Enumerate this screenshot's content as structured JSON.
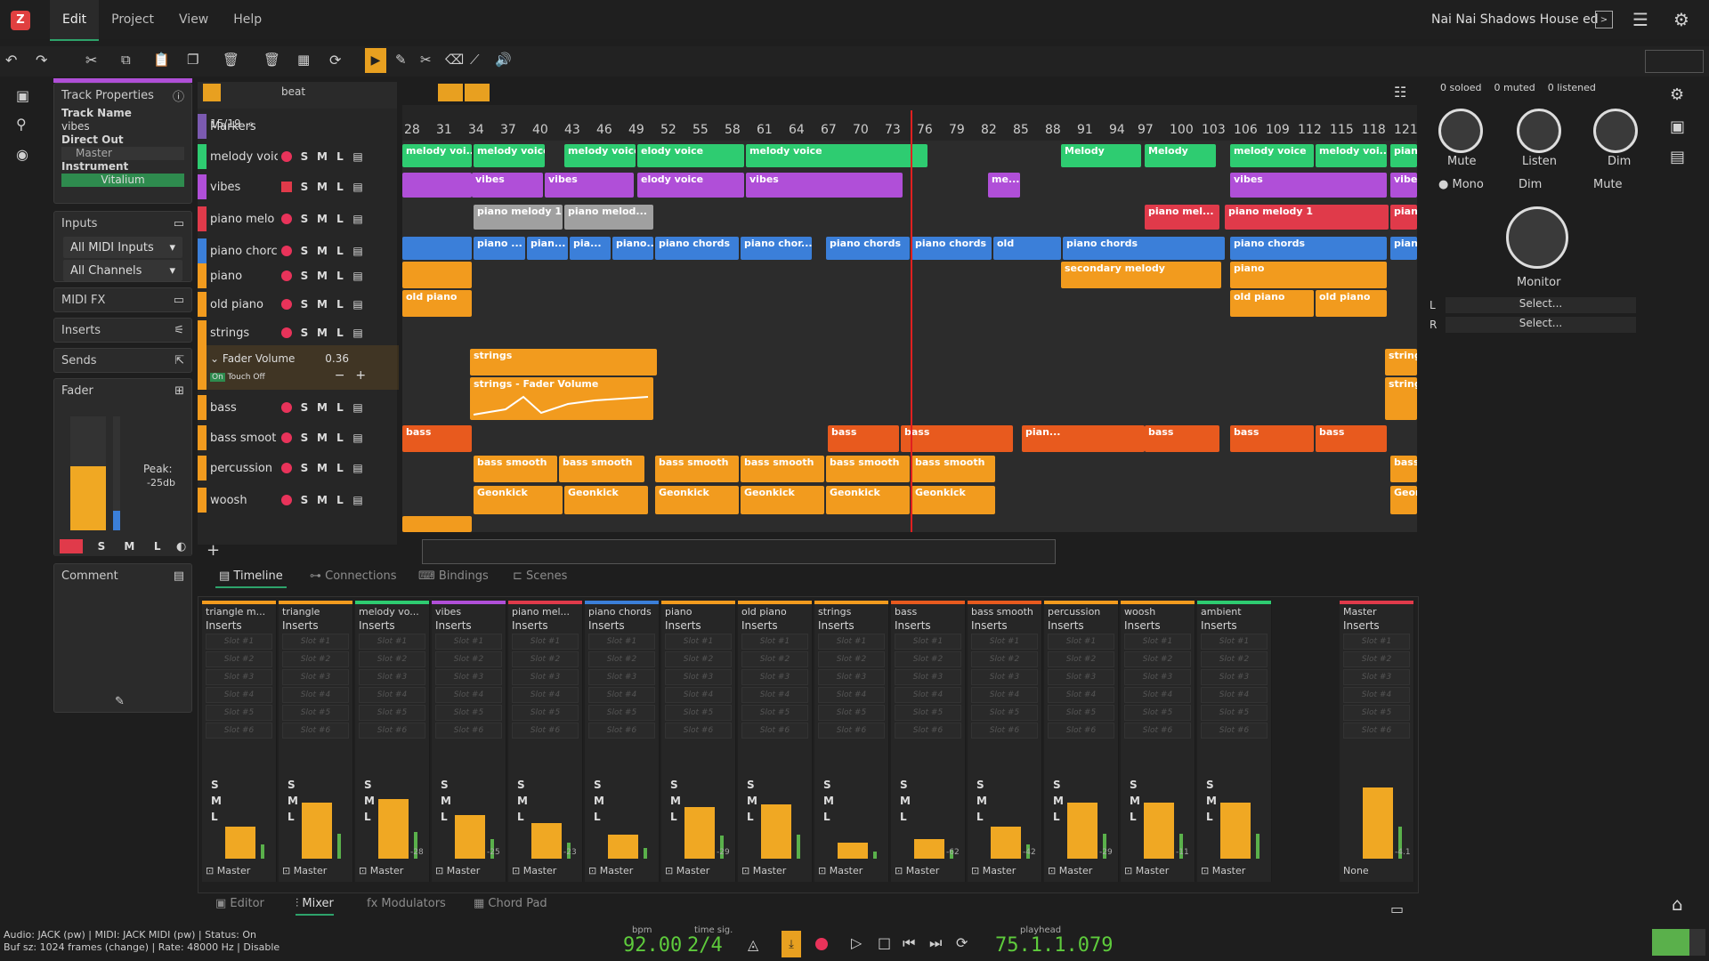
{
  "app": {
    "menu": [
      "Edit",
      "Project",
      "View",
      "Help"
    ],
    "project_name": "Nai Nai Shadows House ed"
  },
  "left": {
    "track_properties": "Track Properties",
    "track_name_lbl": "Track Name",
    "track_name": "vibes",
    "direct_out_lbl": "Direct Out",
    "direct_out": "Master",
    "instrument_lbl": "Instrument",
    "instrument": "Vitalium",
    "inputs": "Inputs",
    "midi_inputs": "All MIDI Inputs",
    "channels": "All Channels",
    "midi_fx": "MIDI FX",
    "inserts": "Inserts",
    "sends": "Sends",
    "fader": "Fader",
    "peak": "Peak:",
    "peak_val": "-25db",
    "comment": "Comment"
  },
  "tracklist": {
    "counter": "15/19",
    "markers": "Markers",
    "snap": "beat",
    "fader_volume": "Fader Volume",
    "fader_value": "0.36",
    "on": "On",
    "touch": "Touch",
    "off": "Off"
  },
  "tracks": [
    {
      "name": "melody voic",
      "color": "#2ecc71"
    },
    {
      "name": "vibes",
      "color": "#b04fd8"
    },
    {
      "name": "piano melo",
      "color": "#e03a4a"
    },
    {
      "name": "piano chorc",
      "color": "#3b7fd9"
    },
    {
      "name": "piano",
      "color": "#f29b1e"
    },
    {
      "name": "old piano",
      "color": "#f29b1e"
    },
    {
      "name": "strings",
      "color": "#f29b1e"
    },
    {
      "name": "bass",
      "color": "#f29b1e"
    },
    {
      "name": "bass smoot",
      "color": "#f29b1e"
    },
    {
      "name": "percussion",
      "color": "#f29b1e"
    },
    {
      "name": "woosh",
      "color": "#f29b1e"
    }
  ],
  "ruler": [
    "28",
    "31",
    "34",
    "37",
    "40",
    "43",
    "46",
    "49",
    "52",
    "55",
    "58",
    "61",
    "64",
    "67",
    "70",
    "73",
    "76",
    "79",
    "82",
    "85",
    "88",
    "91",
    "94",
    "97",
    "100",
    "103",
    "106",
    "109",
    "112",
    "115",
    "118",
    "121"
  ],
  "clips": {
    "melody": [
      "melody voi...",
      "melody voice",
      "melody voice",
      "elody voice",
      "melody voice",
      "Melody",
      "Melody",
      "melody voice",
      "melody voi...",
      "pian"
    ],
    "vibes": [
      "vibes",
      "vibes",
      "vibes",
      "elody voice",
      "vibes",
      "me...",
      "vibes",
      "vibes"
    ],
    "pmel": [
      "piano melody 1",
      "piano melod...",
      "piano mel...",
      "piano melody 1",
      "pian"
    ],
    "pch": [
      "piano ...",
      "pian...",
      "pia...",
      "piano...",
      "piano chords",
      "piano chor...",
      "piano chords",
      "piano chords",
      "old",
      "piano chords",
      "piano chords",
      "pian"
    ],
    "piano": [
      "secondary melody",
      "piano"
    ],
    "old": [
      "old piano",
      "old piano",
      "old piano"
    ],
    "strings": [
      "strings",
      "string",
      "strings - Fader Volume",
      "string"
    ],
    "bass": [
      "bass",
      "bass",
      "bass",
      "pian...",
      "bass",
      "bass",
      "bass",
      "bass"
    ],
    "bsm": [
      "bass smooth",
      "bass smooth",
      "bass smooth",
      "bass smooth",
      "bass smooth",
      "bass smooth",
      "bass"
    ],
    "perc": [
      "Geonkick",
      "Geonkick",
      "Geonkick",
      "Geonkick",
      "Geonkick",
      "Geonkick",
      "Geon"
    ]
  },
  "bottom_tabs": [
    "Timeline",
    "Connections",
    "Bindings",
    "Scenes"
  ],
  "mixer": {
    "channels": [
      {
        "name": "triangle m...",
        "color": "#f29b1e",
        "db": ""
      },
      {
        "name": "triangle",
        "color": "#f29b1e",
        "db": ""
      },
      {
        "name": "melody vo...",
        "color": "#2ecc71",
        "db": "-28"
      },
      {
        "name": "vibes",
        "color": "#b04fd8",
        "db": "-25"
      },
      {
        "name": "piano mel...",
        "color": "#e03a4a",
        "db": "-23"
      },
      {
        "name": "piano chords",
        "color": "#3b7fd9",
        "db": ""
      },
      {
        "name": "piano",
        "color": "#f29b1e",
        "db": "-29"
      },
      {
        "name": "old piano",
        "color": "#f29b1e",
        "db": ""
      },
      {
        "name": "strings",
        "color": "#f29b1e",
        "db": ""
      },
      {
        "name": "bass",
        "color": "#e85a1e",
        "db": "-62"
      },
      {
        "name": "bass smooth",
        "color": "#e85a1e",
        "db": "-42"
      },
      {
        "name": "percussion",
        "color": "#f29b1e",
        "db": "-29"
      },
      {
        "name": "woosh",
        "color": "#f29b1e",
        "db": "-11"
      },
      {
        "name": "ambient",
        "color": "#2ecc71",
        "db": ""
      }
    ],
    "inserts": "Inserts",
    "slots": [
      "Slot #1",
      "Slot #2",
      "Slot #3",
      "Slot #4",
      "Slot #5",
      "Slot #6"
    ],
    "out": "Master",
    "master": "Master",
    "master_out": "None",
    "master_db": "-4.1"
  },
  "bottom_nav": [
    "Editor",
    "Mixer",
    "Modulators",
    "Chord Pad"
  ],
  "transport": {
    "bpm_lbl": "bpm",
    "bpm": "92.00",
    "ts_lbl": "time sig.",
    "ts": "2/4",
    "ph_lbl": "playhead",
    "playhead": "75.1.1.079"
  },
  "status": {
    "line1": "Audio: JACK (pw) | MIDI: JACK MIDI (pw) | Status: On",
    "line2": "Buf sz: 1024 frames (change) | Rate: 48000 Hz | Disable"
  },
  "monitor": {
    "soloed": "0 soloed",
    "muted": "0 muted",
    "listened": "0 listened",
    "mute": "Mute",
    "listen": "Listen",
    "dim": "Dim",
    "mono": "Mono",
    "dim_btn": "Dim",
    "mute_btn": "Mute",
    "monitor": "Monitor",
    "l": "L",
    "r": "R",
    "select": "Select..."
  }
}
